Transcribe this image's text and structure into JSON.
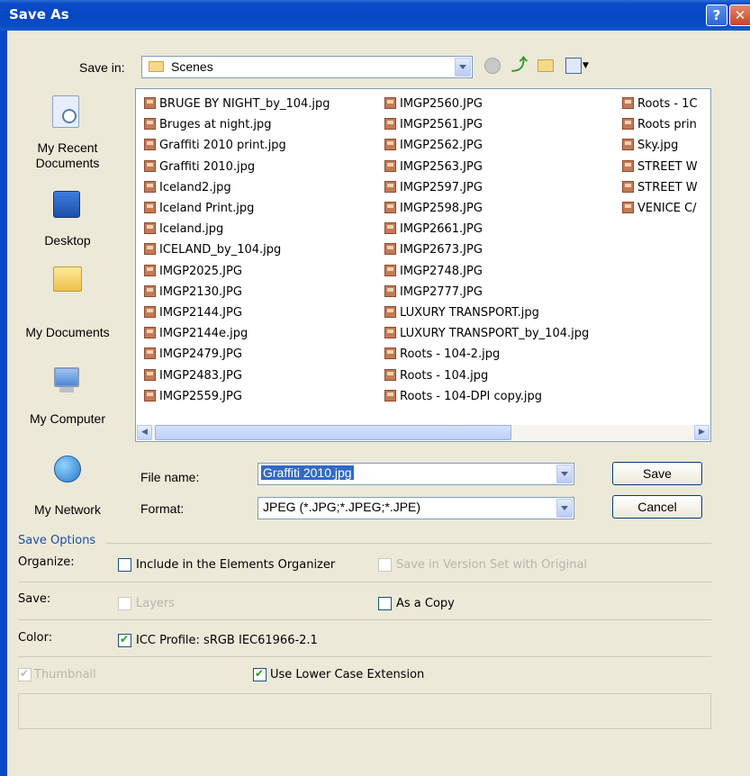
{
  "window": {
    "title": "Save As"
  },
  "titlebar": {
    "help_label": "?",
    "close_label": "✕"
  },
  "save_in": {
    "label": "Save in:",
    "value": "Scenes"
  },
  "places": [
    {
      "name": "my-recent-documents",
      "label_line1": "My Recent",
      "label_line2": "Documents",
      "icon": "recent-documents-icon"
    },
    {
      "name": "desktop",
      "label_line1": "Desktop",
      "label_line2": "",
      "icon": "desktop-icon"
    },
    {
      "name": "my-documents",
      "label_line1": "My Documents",
      "label_line2": "",
      "icon": "my-documents-icon"
    },
    {
      "name": "my-computer",
      "label_line1": "My Computer",
      "label_line2": "",
      "icon": "my-computer-icon"
    },
    {
      "name": "my-network",
      "label_line1": "My Network",
      "label_line2": "",
      "icon": "my-network-icon"
    }
  ],
  "files": {
    "column1": [
      "BRUGE BY NIGHT_by_104.jpg",
      "Bruges at night.jpg",
      "Graffiti 2010 print.jpg",
      "Graffiti 2010.jpg",
      "Iceland2.jpg",
      "Iceland Print.jpg",
      "Iceland.jpg",
      "ICELAND_by_104.jpg",
      "IMGP2025.JPG",
      "IMGP2130.JPG",
      "IMGP2144.JPG",
      "IMGP2144e.jpg",
      "IMGP2479.JPG",
      "IMGP2483.JPG",
      "IMGP2559.JPG"
    ],
    "column2": [
      "IMGP2560.JPG",
      "IMGP2561.JPG",
      "IMGP2562.JPG",
      "IMGP2563.JPG",
      "IMGP2597.JPG",
      "IMGP2598.JPG",
      "IMGP2661.JPG",
      "IMGP2673.JPG",
      "IMGP2748.JPG",
      "IMGP2777.JPG",
      "LUXURY TRANSPORT.jpg",
      "LUXURY TRANSPORT_by_104.jpg",
      "Roots - 104-2.jpg",
      "Roots - 104.jpg",
      "Roots - 104-DPI copy.jpg"
    ],
    "column3": [
      "Roots - 1C",
      "Roots prin",
      "Sky.jpg",
      "STREET W",
      "STREET W",
      "VENICE C/"
    ]
  },
  "file_name": {
    "label": "File name:",
    "value": "Graffiti 2010.jpg"
  },
  "format": {
    "label": "Format:",
    "value": "JPEG (*.JPG;*.JPEG;*.JPE)"
  },
  "buttons": {
    "save": "Save",
    "cancel": "Cancel"
  },
  "options": {
    "section_title": "Save Options",
    "organize_label": "Organize:",
    "include_organizer": "Include in the Elements Organizer",
    "version_set": "Save in Version Set with Original",
    "save_label": "Save:",
    "layers": "Layers",
    "as_copy": "As a Copy",
    "color_label": "Color:",
    "icc_profile": "ICC Profile:  sRGB IEC61966-2.1",
    "thumbnail": "Thumbnail",
    "lower_case": "Use Lower Case Extension"
  },
  "colors": {
    "titlebar": "#0548c4",
    "dialog_bg": "#ece9d8",
    "section_title": "#1c4fa8",
    "selection": "#316ac5"
  }
}
